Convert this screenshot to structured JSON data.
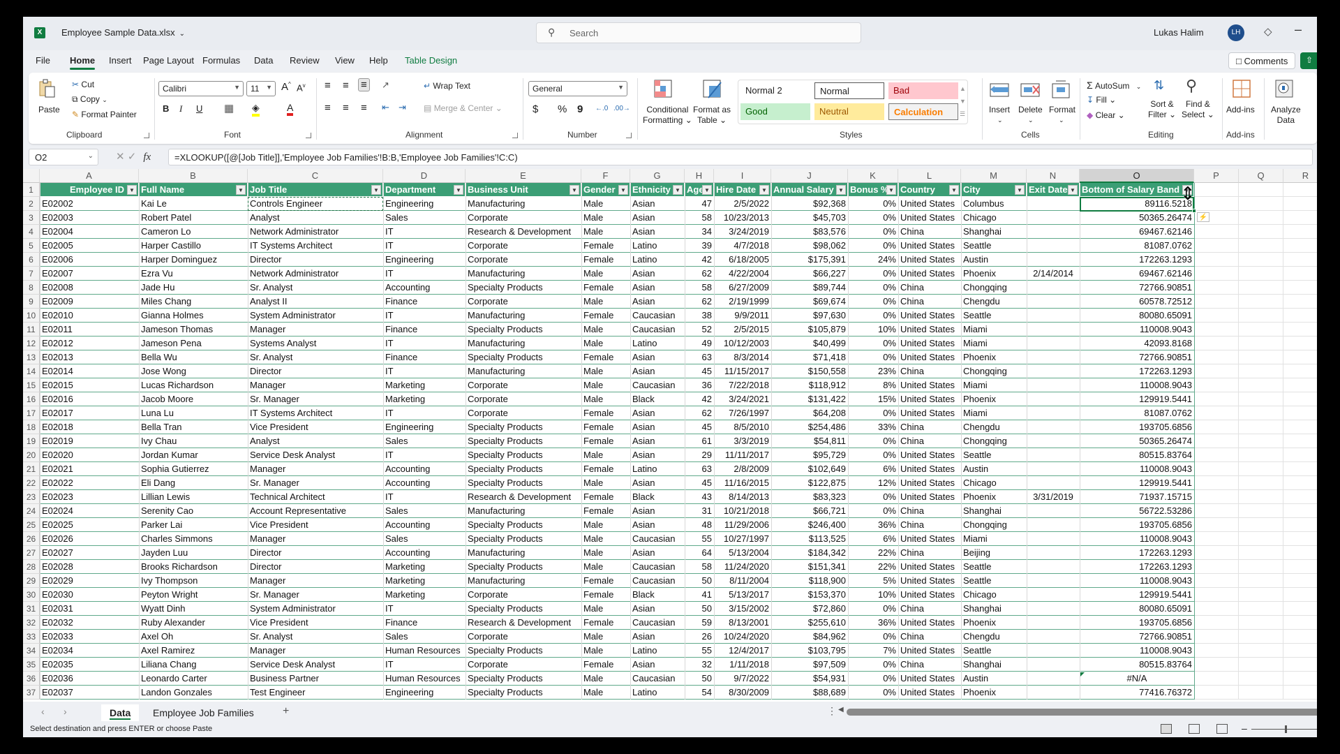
{
  "title_bar": {
    "app_icon": "excel-icon",
    "document_title": "Employee Sample Data.xlsx",
    "search_placeholder": "Search",
    "user_name": "Lukas Halim",
    "user_initials": "LH"
  },
  "menu": {
    "tabs": [
      "File",
      "Home",
      "Insert",
      "Page Layout",
      "Formulas",
      "Data",
      "Review",
      "View",
      "Help",
      "Table Design"
    ],
    "active_tab": "Home",
    "comments_label": "Comments"
  },
  "ribbon": {
    "clipboard": {
      "paste": "Paste",
      "cut": "Cut",
      "copy": "Copy",
      "format_painter": "Format Painter",
      "label": "Clipboard"
    },
    "font": {
      "family": "Calibri",
      "size": "11",
      "bold": "B",
      "italic": "I",
      "underline": "U",
      "label": "Font",
      "highlight_color": "#ffff00",
      "font_color": "#e02020"
    },
    "alignment": {
      "wrap_text": "Wrap Text",
      "merge_center": "Merge & Center",
      "label": "Alignment"
    },
    "number": {
      "format": "General",
      "currency": "$",
      "percent": "%",
      "comma": "9",
      "label": "Number"
    },
    "styles": {
      "conditional_formatting": [
        "Conditional",
        "Formatting"
      ],
      "format_as_table": [
        "Format as",
        "Table"
      ],
      "cells": [
        {
          "name": "Normal 2",
          "bg": "#ffffff",
          "fg": "#222222"
        },
        {
          "name": "Normal",
          "bg": "#ffffff",
          "fg": "#222222"
        },
        {
          "name": "Bad",
          "bg": "#ffc7ce",
          "fg": "#9c0006"
        },
        {
          "name": "Good",
          "bg": "#c6efce",
          "fg": "#006100"
        },
        {
          "name": "Neutral",
          "bg": "#ffeb9c",
          "fg": "#9c5700"
        },
        {
          "name": "Calculation",
          "bg": "#f2f2f2",
          "fg": "#fa7d00"
        }
      ],
      "label": "Styles"
    },
    "cells": {
      "insert": "Insert",
      "delete": "Delete",
      "format": "Format",
      "label": "Cells"
    },
    "editing": {
      "autosum": "AutoSum",
      "fill": "Fill",
      "clear": "Clear",
      "sort_filter": [
        "Sort &",
        "Filter"
      ],
      "find_select": [
        "Find &",
        "Select"
      ],
      "label": "Editing"
    },
    "addins": {
      "addins": "Add-ins",
      "analyze": [
        "Analyze",
        "Data"
      ],
      "label": "Add-ins"
    }
  },
  "formula_bar": {
    "name_box": "O2",
    "formula": "=XLOOKUP([@[Job Title]],'Employee Job Families'!B:B,'Employee Job Families'!C:C)"
  },
  "sheet": {
    "column_letters": [
      "A",
      "B",
      "C",
      "D",
      "E",
      "F",
      "G",
      "H",
      "I",
      "J",
      "K",
      "L",
      "M",
      "N",
      "O",
      "P",
      "Q",
      "R"
    ],
    "selected_column": "O",
    "headers": [
      "Employee ID",
      "Full Name",
      "Job Title",
      "Department",
      "Business Unit",
      "Gender",
      "Ethnicity",
      "Age",
      "Hire Date",
      "Annual Salary",
      "Bonus %",
      "Country",
      "City",
      "Exit Date",
      "Bottom of Salary Band"
    ],
    "rows": [
      [
        "E02002",
        "Kai Le",
        "Controls Engineer",
        "Engineering",
        "Manufacturing",
        "Male",
        "Asian",
        "47",
        "2/5/2022",
        "$92,368",
        "0%",
        "United States",
        "Columbus",
        "",
        "89116.5218"
      ],
      [
        "E02003",
        "Robert Patel",
        "Analyst",
        "Sales",
        "Corporate",
        "Male",
        "Asian",
        "58",
        "10/23/2013",
        "$45,703",
        "0%",
        "United States",
        "Chicago",
        "",
        "50365.26474"
      ],
      [
        "E02004",
        "Cameron Lo",
        "Network Administrator",
        "IT",
        "Research & Development",
        "Male",
        "Asian",
        "34",
        "3/24/2019",
        "$83,576",
        "0%",
        "China",
        "Shanghai",
        "",
        "69467.62146"
      ],
      [
        "E02005",
        "Harper Castillo",
        "IT Systems Architect",
        "IT",
        "Corporate",
        "Female",
        "Latino",
        "39",
        "4/7/2018",
        "$98,062",
        "0%",
        "United States",
        "Seattle",
        "",
        "81087.0762"
      ],
      [
        "E02006",
        "Harper Dominguez",
        "Director",
        "Engineering",
        "Corporate",
        "Female",
        "Latino",
        "42",
        "6/18/2005",
        "$175,391",
        "24%",
        "United States",
        "Austin",
        "",
        "172263.1293"
      ],
      [
        "E02007",
        "Ezra Vu",
        "Network Administrator",
        "IT",
        "Manufacturing",
        "Male",
        "Asian",
        "62",
        "4/22/2004",
        "$66,227",
        "0%",
        "United States",
        "Phoenix",
        "2/14/2014",
        "69467.62146"
      ],
      [
        "E02008",
        "Jade Hu",
        "Sr. Analyst",
        "Accounting",
        "Specialty Products",
        "Female",
        "Asian",
        "58",
        "6/27/2009",
        "$89,744",
        "0%",
        "China",
        "Chongqing",
        "",
        "72766.90851"
      ],
      [
        "E02009",
        "Miles Chang",
        "Analyst II",
        "Finance",
        "Corporate",
        "Male",
        "Asian",
        "62",
        "2/19/1999",
        "$69,674",
        "0%",
        "China",
        "Chengdu",
        "",
        "60578.72512"
      ],
      [
        "E02010",
        "Gianna Holmes",
        "System Administrator",
        "IT",
        "Manufacturing",
        "Female",
        "Caucasian",
        "38",
        "9/9/2011",
        "$97,630",
        "0%",
        "United States",
        "Seattle",
        "",
        "80080.65091"
      ],
      [
        "E02011",
        "Jameson Thomas",
        "Manager",
        "Finance",
        "Specialty Products",
        "Male",
        "Caucasian",
        "52",
        "2/5/2015",
        "$105,879",
        "10%",
        "United States",
        "Miami",
        "",
        "110008.9043"
      ],
      [
        "E02012",
        "Jameson Pena",
        "Systems Analyst",
        "IT",
        "Manufacturing",
        "Male",
        "Latino",
        "49",
        "10/12/2003",
        "$40,499",
        "0%",
        "United States",
        "Miami",
        "",
        "42093.8168"
      ],
      [
        "E02013",
        "Bella Wu",
        "Sr. Analyst",
        "Finance",
        "Specialty Products",
        "Female",
        "Asian",
        "63",
        "8/3/2014",
        "$71,418",
        "0%",
        "United States",
        "Phoenix",
        "",
        "72766.90851"
      ],
      [
        "E02014",
        "Jose Wong",
        "Director",
        "IT",
        "Manufacturing",
        "Male",
        "Asian",
        "45",
        "11/15/2017",
        "$150,558",
        "23%",
        "China",
        "Chongqing",
        "",
        "172263.1293"
      ],
      [
        "E02015",
        "Lucas Richardson",
        "Manager",
        "Marketing",
        "Corporate",
        "Male",
        "Caucasian",
        "36",
        "7/22/2018",
        "$118,912",
        "8%",
        "United States",
        "Miami",
        "",
        "110008.9043"
      ],
      [
        "E02016",
        "Jacob Moore",
        "Sr. Manager",
        "Marketing",
        "Corporate",
        "Male",
        "Black",
        "42",
        "3/24/2021",
        "$131,422",
        "15%",
        "United States",
        "Phoenix",
        "",
        "129919.5441"
      ],
      [
        "E02017",
        "Luna Lu",
        "IT Systems Architect",
        "IT",
        "Corporate",
        "Female",
        "Asian",
        "62",
        "7/26/1997",
        "$64,208",
        "0%",
        "United States",
        "Miami",
        "",
        "81087.0762"
      ],
      [
        "E02018",
        "Bella Tran",
        "Vice President",
        "Engineering",
        "Specialty Products",
        "Female",
        "Asian",
        "45",
        "8/5/2010",
        "$254,486",
        "33%",
        "China",
        "Chengdu",
        "",
        "193705.6856"
      ],
      [
        "E02019",
        "Ivy Chau",
        "Analyst",
        "Sales",
        "Specialty Products",
        "Female",
        "Asian",
        "61",
        "3/3/2019",
        "$54,811",
        "0%",
        "China",
        "Chongqing",
        "",
        "50365.26474"
      ],
      [
        "E02020",
        "Jordan Kumar",
        "Service Desk Analyst",
        "IT",
        "Specialty Products",
        "Male",
        "Asian",
        "29",
        "11/11/2017",
        "$95,729",
        "0%",
        "United States",
        "Seattle",
        "",
        "80515.83764"
      ],
      [
        "E02021",
        "Sophia Gutierrez",
        "Manager",
        "Accounting",
        "Specialty Products",
        "Female",
        "Latino",
        "63",
        "2/8/2009",
        "$102,649",
        "6%",
        "United States",
        "Austin",
        "",
        "110008.9043"
      ],
      [
        "E02022",
        "Eli Dang",
        "Sr. Manager",
        "Accounting",
        "Specialty Products",
        "Male",
        "Asian",
        "45",
        "11/16/2015",
        "$122,875",
        "12%",
        "United States",
        "Chicago",
        "",
        "129919.5441"
      ],
      [
        "E02023",
        "Lillian Lewis",
        "Technical Architect",
        "IT",
        "Research & Development",
        "Female",
        "Black",
        "43",
        "8/14/2013",
        "$83,323",
        "0%",
        "United States",
        "Phoenix",
        "3/31/2019",
        "71937.15715"
      ],
      [
        "E02024",
        "Serenity Cao",
        "Account Representative",
        "Sales",
        "Manufacturing",
        "Female",
        "Asian",
        "31",
        "10/21/2018",
        "$66,721",
        "0%",
        "China",
        "Shanghai",
        "",
        "56722.53286"
      ],
      [
        "E02025",
        "Parker Lai",
        "Vice President",
        "Accounting",
        "Specialty Products",
        "Male",
        "Asian",
        "48",
        "11/29/2006",
        "$246,400",
        "36%",
        "China",
        "Chongqing",
        "",
        "193705.6856"
      ],
      [
        "E02026",
        "Charles Simmons",
        "Manager",
        "Sales",
        "Specialty Products",
        "Male",
        "Caucasian",
        "55",
        "10/27/1997",
        "$113,525",
        "6%",
        "United States",
        "Miami",
        "",
        "110008.9043"
      ],
      [
        "E02027",
        "Jayden Luu",
        "Director",
        "Accounting",
        "Manufacturing",
        "Male",
        "Asian",
        "64",
        "5/13/2004",
        "$184,342",
        "22%",
        "China",
        "Beijing",
        "",
        "172263.1293"
      ],
      [
        "E02028",
        "Brooks Richardson",
        "Director",
        "Marketing",
        "Specialty Products",
        "Male",
        "Caucasian",
        "58",
        "11/24/2020",
        "$151,341",
        "22%",
        "United States",
        "Seattle",
        "",
        "172263.1293"
      ],
      [
        "E02029",
        "Ivy Thompson",
        "Manager",
        "Marketing",
        "Manufacturing",
        "Female",
        "Caucasian",
        "50",
        "8/11/2004",
        "$118,900",
        "5%",
        "United States",
        "Seattle",
        "",
        "110008.9043"
      ],
      [
        "E02030",
        "Peyton Wright",
        "Sr. Manager",
        "Marketing",
        "Corporate",
        "Female",
        "Black",
        "41",
        "5/13/2017",
        "$153,370",
        "10%",
        "United States",
        "Chicago",
        "",
        "129919.5441"
      ],
      [
        "E02031",
        "Wyatt Dinh",
        "System Administrator",
        "IT",
        "Specialty Products",
        "Male",
        "Asian",
        "50",
        "3/15/2002",
        "$72,860",
        "0%",
        "China",
        "Shanghai",
        "",
        "80080.65091"
      ],
      [
        "E02032",
        "Ruby Alexander",
        "Vice President",
        "Finance",
        "Research & Development",
        "Female",
        "Caucasian",
        "59",
        "8/13/2001",
        "$255,610",
        "36%",
        "United States",
        "Phoenix",
        "",
        "193705.6856"
      ],
      [
        "E02033",
        "Axel Oh",
        "Sr. Analyst",
        "Sales",
        "Corporate",
        "Male",
        "Asian",
        "26",
        "10/24/2020",
        "$84,962",
        "0%",
        "China",
        "Chengdu",
        "",
        "72766.90851"
      ],
      [
        "E02034",
        "Axel Ramirez",
        "Manager",
        "Human Resources",
        "Specialty Products",
        "Male",
        "Latino",
        "55",
        "12/4/2017",
        "$103,795",
        "7%",
        "United States",
        "Seattle",
        "",
        "110008.9043"
      ],
      [
        "E02035",
        "Liliana Chang",
        "Service Desk Analyst",
        "IT",
        "Corporate",
        "Female",
        "Asian",
        "32",
        "1/11/2018",
        "$97,509",
        "0%",
        "China",
        "Shanghai",
        "",
        "80515.83764"
      ],
      [
        "E02036",
        "Leonardo Carter",
        "Business Partner",
        "Human Resources",
        "Specialty Products",
        "Male",
        "Caucasian",
        "50",
        "9/7/2022",
        "$54,931",
        "0%",
        "United States",
        "Austin",
        "",
        "#N/A"
      ],
      [
        "E02037",
        "Landon Gonzales",
        "Test Engineer",
        "Engineering",
        "Specialty Products",
        "Male",
        "Latino",
        "54",
        "8/30/2009",
        "$88,689",
        "0%",
        "United States",
        "Phoenix",
        "",
        "77416.76372"
      ]
    ],
    "header_color": "#3b9e75"
  },
  "sheet_tabs": {
    "tabs": [
      "Data",
      "Employee Job Families"
    ],
    "active": "Data"
  },
  "status_bar": {
    "message": "Select destination and press ENTER or choose Paste"
  }
}
